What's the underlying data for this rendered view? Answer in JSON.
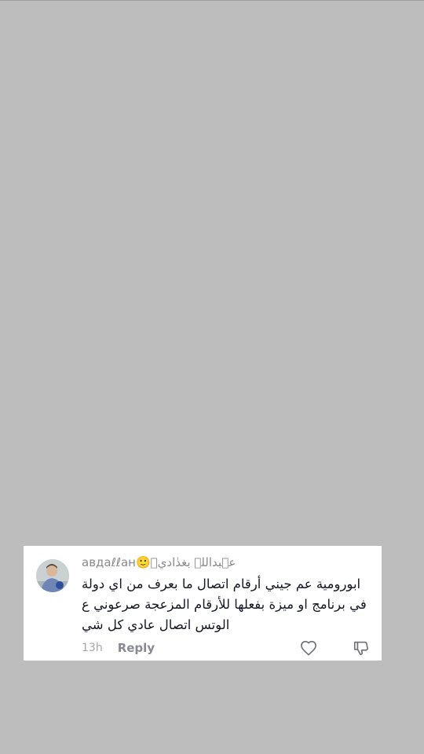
{
  "comment": {
    "username": "aвдaℓℓaн🙂عٖبداللہ بغدٰاديٖ",
    "text": "ابورومية عم جيني أرقام اتصال ما بعرف من اي دولة في برنامج او ميزة بفعلها للأرقام المزعجة صرعوني ع الوتس اتصال عادي كل شي",
    "timestamp": "13h",
    "reply_label": "Reply",
    "icons": {
      "avatar": "avatar",
      "like": "heart-outline-icon",
      "dislike": "thumbs-down-outline-icon"
    }
  },
  "colors": {
    "background": "#bdbdbd",
    "card": "#ffffff",
    "text": "#161823",
    "muted": "#8a8a8a"
  }
}
